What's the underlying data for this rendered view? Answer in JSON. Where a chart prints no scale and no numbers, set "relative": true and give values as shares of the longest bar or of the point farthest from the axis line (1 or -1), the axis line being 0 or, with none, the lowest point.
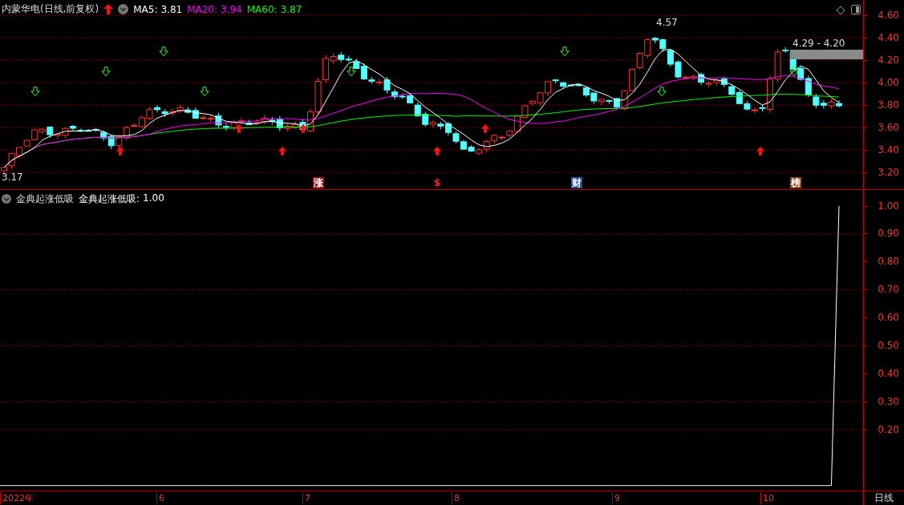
{
  "header": {
    "title": "内蒙华电(日线,前复权)",
    "ma": [
      {
        "label": "MA5:",
        "value": "3.81",
        "color": "#ffffff"
      },
      {
        "label": "MA20:",
        "value": "3.94",
        "color": "#ff00ff"
      },
      {
        "label": "MA60:",
        "value": "3.87",
        "color": "#00ff00"
      }
    ]
  },
  "price_axis": {
    "ticks": [
      "4.60",
      "4.40",
      "4.20",
      "4.00",
      "3.80",
      "3.60",
      "3.40",
      "3.20"
    ]
  },
  "annotations": {
    "high": "4.57",
    "low": "3.17",
    "range": "4.29 - 4.20"
  },
  "events": [
    {
      "label": "涨",
      "kind": "filled",
      "color": "#a01010"
    },
    {
      "label": "$",
      "kind": "plain",
      "color": "#ff2020"
    },
    {
      "label": "财",
      "kind": "filled",
      "color": "#1e4f9a"
    },
    {
      "label": "榜",
      "kind": "filled",
      "color": "#8a4a10"
    }
  ],
  "indicator": {
    "reading_label": "金典起涨低吸:",
    "reading": "1.00",
    "chart_data": {
      "type": "line",
      "series": [
        {
          "name": "金典起涨低吸",
          "color": "#ffffff",
          "values": [
            0,
            0,
            0,
            0,
            0,
            0,
            0,
            0,
            0,
            0,
            0,
            0,
            0,
            0,
            0,
            0,
            0,
            0,
            0,
            0,
            0,
            0,
            0,
            0,
            0,
            0,
            0,
            0,
            0,
            0,
            0,
            0,
            0,
            0,
            0,
            0,
            0,
            0,
            0,
            0,
            0,
            0,
            0,
            0,
            0,
            0,
            0,
            0,
            0,
            0,
            0,
            0,
            0,
            0,
            0,
            0,
            0,
            0,
            0,
            0,
            0,
            0,
            0,
            0,
            0,
            0,
            0,
            0,
            0,
            0,
            0,
            0,
            0,
            0,
            0,
            0,
            0,
            0,
            0,
            0,
            0,
            0,
            0,
            0,
            0,
            0,
            0,
            0,
            0,
            0,
            0,
            0,
            0,
            0,
            0,
            0,
            0,
            0,
            0,
            0,
            0,
            0,
            0,
            0,
            0,
            0,
            0,
            0,
            0,
            1
          ]
        }
      ],
      "relative": true
    },
    "axis_ticks": [
      "1.00",
      "0.90",
      "0.80",
      "0.70",
      "0.60",
      "0.50",
      "0.40",
      "0.30",
      "0.20"
    ]
  },
  "x_axis": {
    "labels": [
      "2022年",
      "6",
      "7",
      "8",
      "9",
      "10"
    ],
    "period": "日线"
  }
}
